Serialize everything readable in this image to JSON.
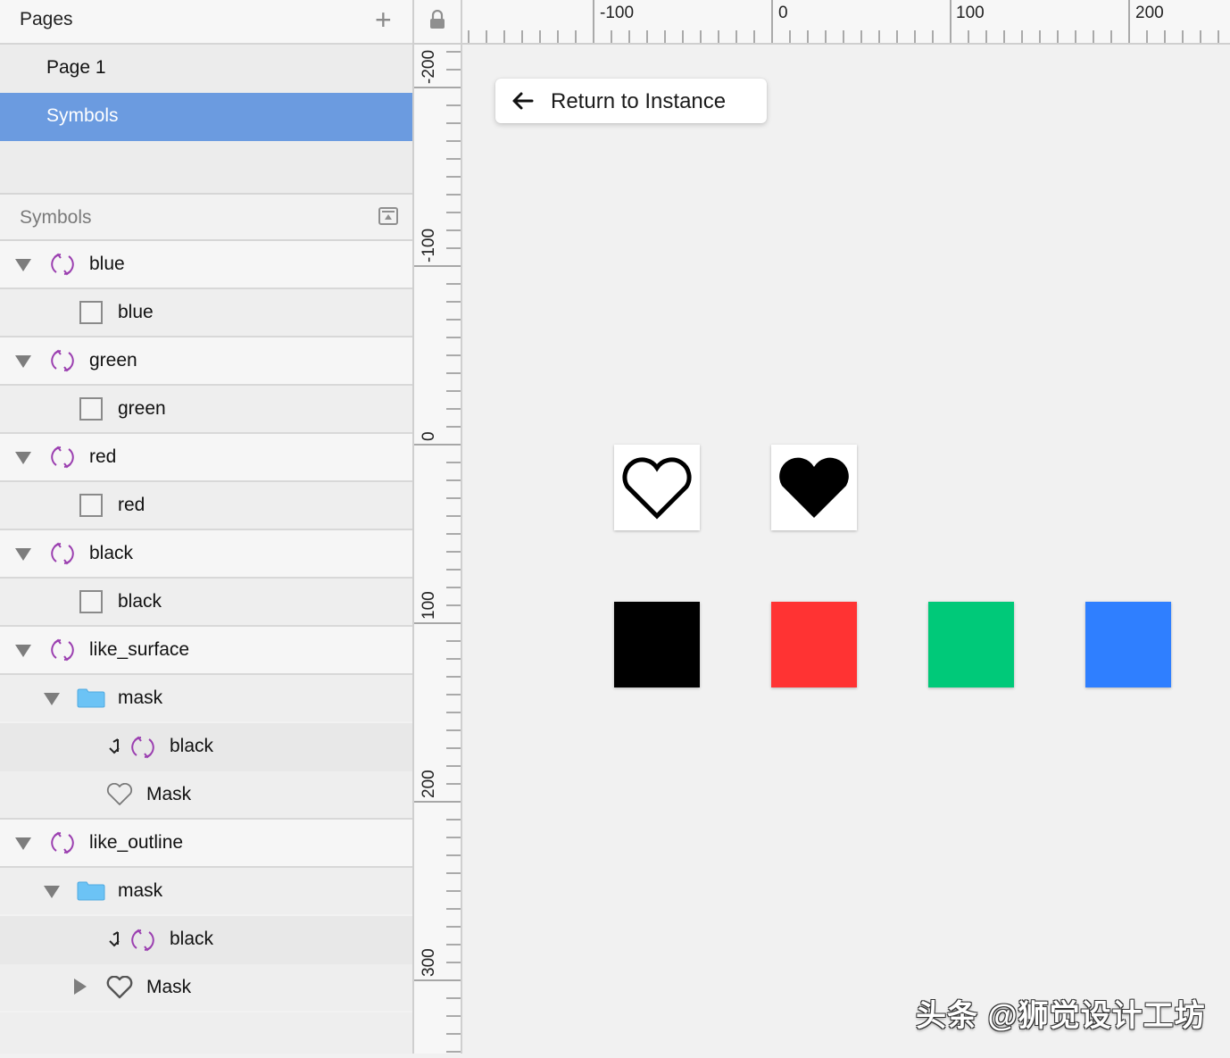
{
  "pages": {
    "title": "Pages",
    "add_icon": "plus-icon",
    "items": [
      {
        "label": "Page 1",
        "selected": false
      },
      {
        "label": "Symbols",
        "selected": true
      }
    ]
  },
  "layers": {
    "title": "Symbols",
    "collapse_icon": "collapse-panel-icon",
    "rows": [
      {
        "label": "blue",
        "type": "symbol",
        "expanded": true
      },
      {
        "label": "blue",
        "type": "rectangle"
      },
      {
        "label": "green",
        "type": "symbol",
        "expanded": true
      },
      {
        "label": "green",
        "type": "rectangle"
      },
      {
        "label": "red",
        "type": "symbol",
        "expanded": true
      },
      {
        "label": "red",
        "type": "rectangle"
      },
      {
        "label": "black",
        "type": "symbol",
        "expanded": true
      },
      {
        "label": "black",
        "type": "rectangle"
      },
      {
        "label": "like_surface",
        "type": "symbol",
        "expanded": true
      },
      {
        "label": "mask",
        "type": "group",
        "expanded": true
      },
      {
        "label": "black",
        "type": "masked-symbol"
      },
      {
        "label": "Mask",
        "type": "heart-shape"
      },
      {
        "label": "like_outline",
        "type": "symbol",
        "expanded": true
      },
      {
        "label": "mask",
        "type": "group",
        "expanded": true
      },
      {
        "label": "black",
        "type": "masked-symbol"
      },
      {
        "label": "Mask",
        "type": "heart-shape",
        "expanded": false
      }
    ]
  },
  "rulers": {
    "lock_icon": "lock-icon",
    "horizontal_labels": [
      "-100",
      "0",
      "100",
      "200"
    ],
    "vertical_labels": [
      "-200",
      "-100",
      "0",
      "100",
      "200",
      "300"
    ]
  },
  "canvas": {
    "return_button": "Return to Instance",
    "return_icon": "arrow-left-icon",
    "hearts": [
      {
        "name": "like_outline",
        "style": "outline",
        "color": "#000000"
      },
      {
        "name": "like_surface",
        "style": "filled",
        "color": "#000000"
      }
    ],
    "swatches": [
      {
        "name": "black",
        "color": "#000000"
      },
      {
        "name": "red",
        "color": "#FF3333"
      },
      {
        "name": "green",
        "color": "#00C979"
      },
      {
        "name": "blue",
        "color": "#2F7FFF"
      }
    ]
  },
  "watermark": "头条 @狮觉设计工坊",
  "colors": {
    "selection": "#6b9be0",
    "symbol_icon": "#9b3fb0",
    "folder": "#6cc3f5"
  }
}
